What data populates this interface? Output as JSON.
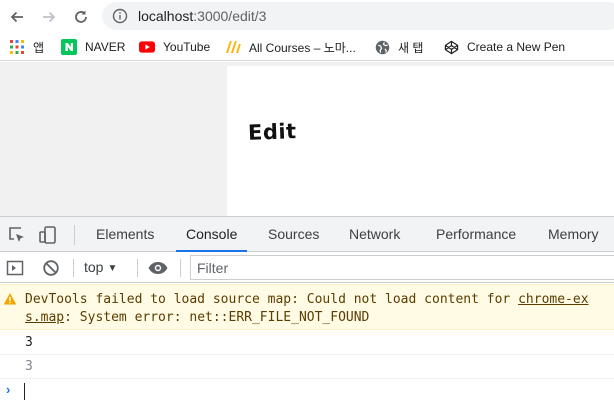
{
  "browser": {
    "url_host": "localhost",
    "url_rest": ":3000/edit/3",
    "bookmarks": [
      {
        "label": "앱",
        "icon": "apps-grid-icon"
      },
      {
        "label": "NAVER",
        "icon": "naver-icon"
      },
      {
        "label": "YouTube",
        "icon": "youtube-icon"
      },
      {
        "label": "All Courses – 노마...",
        "icon": "nomad-icon"
      },
      {
        "label": "새 탭",
        "icon": "globe-icon"
      },
      {
        "label": "Create a New Pen",
        "icon": "codepen-icon"
      }
    ]
  },
  "page": {
    "heading": "Edit"
  },
  "devtools": {
    "tabs": [
      "Elements",
      "Console",
      "Sources",
      "Network",
      "Performance",
      "Memory"
    ],
    "active_tab": "Console",
    "context": "top",
    "filter_placeholder": "Filter",
    "warning": {
      "line1_text": "DevTools failed to load source map: Could not load content for ",
      "line1_link": "chrome-ex",
      "line2_link": "s.map",
      "line2_text": ": System error: net::ERR_FILE_NOT_FOUND"
    },
    "logs": [
      "3",
      "3"
    ],
    "colors": {
      "accent": "#1a73e8",
      "warning_bg": "#fffbe5",
      "warning_text": "#5c3c00"
    }
  }
}
